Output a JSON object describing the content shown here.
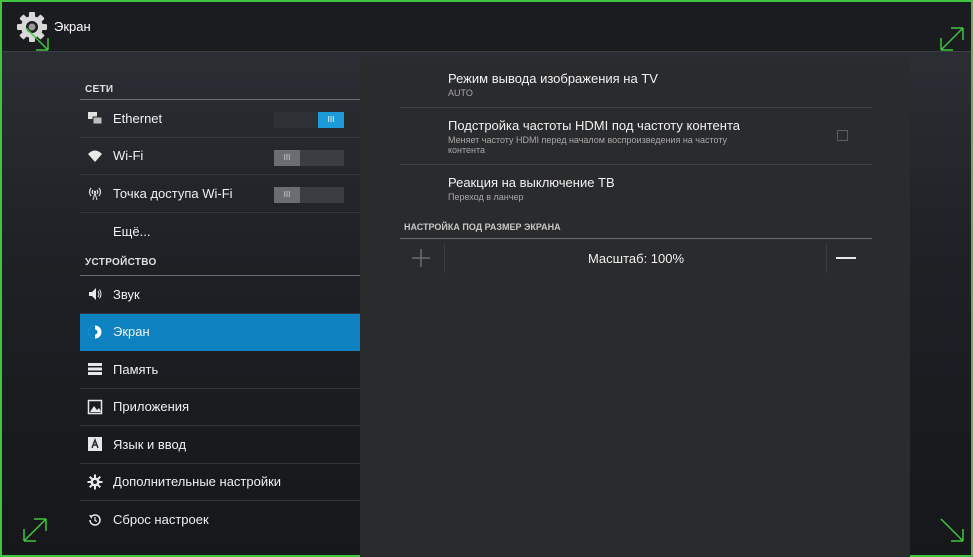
{
  "app": {
    "title": "Экран"
  },
  "sidebar": {
    "networks_header": "СЕТИ",
    "device_header": "УСТРОЙСТВО",
    "items": [
      {
        "label": "Ethernet",
        "icon": "ethernet-icon",
        "toggle": "on",
        "toggle_label": "III"
      },
      {
        "label": "Wi-Fi",
        "icon": "wifi-icon",
        "toggle": "off",
        "toggle_label": "III"
      },
      {
        "label": "Точка доступа Wi-Fi",
        "icon": "hotspot-icon",
        "toggle": "off",
        "toggle_label": "III"
      },
      {
        "label": "Ещё..."
      },
      {
        "label": "Звук",
        "icon": "sound-icon"
      },
      {
        "label": "Экран",
        "icon": "display-icon",
        "selected": true
      },
      {
        "label": "Память",
        "icon": "storage-icon"
      },
      {
        "label": "Приложения",
        "icon": "apps-icon"
      },
      {
        "label": "Язык и ввод",
        "icon": "language-icon"
      },
      {
        "label": "Дополнительные настройки",
        "icon": "gear-icon"
      },
      {
        "label": "Сброс настроек",
        "icon": "reset-icon"
      }
    ]
  },
  "main": {
    "prefs": [
      {
        "title": "Режим вывода изображения на TV",
        "summary": "AUTO"
      },
      {
        "title": "Подстройка частоты HDMI под частоту контента",
        "summary": "Меняет частоту HDMI перед началом воспроизведения на частоту",
        "summary2": "контента",
        "checked": false
      },
      {
        "title": "Реакция на выключение ТВ",
        "summary": "Переход в ланчер"
      }
    ],
    "screen_size_header": "НАСТРОЙКА ПОД РАЗМЕР ЭКРАНА",
    "scale_label": "Масштаб: 100%"
  },
  "colors": {
    "accent": "#0e82c0",
    "toggle_on": "#1d9ad8",
    "frame": "#3fc53f"
  }
}
